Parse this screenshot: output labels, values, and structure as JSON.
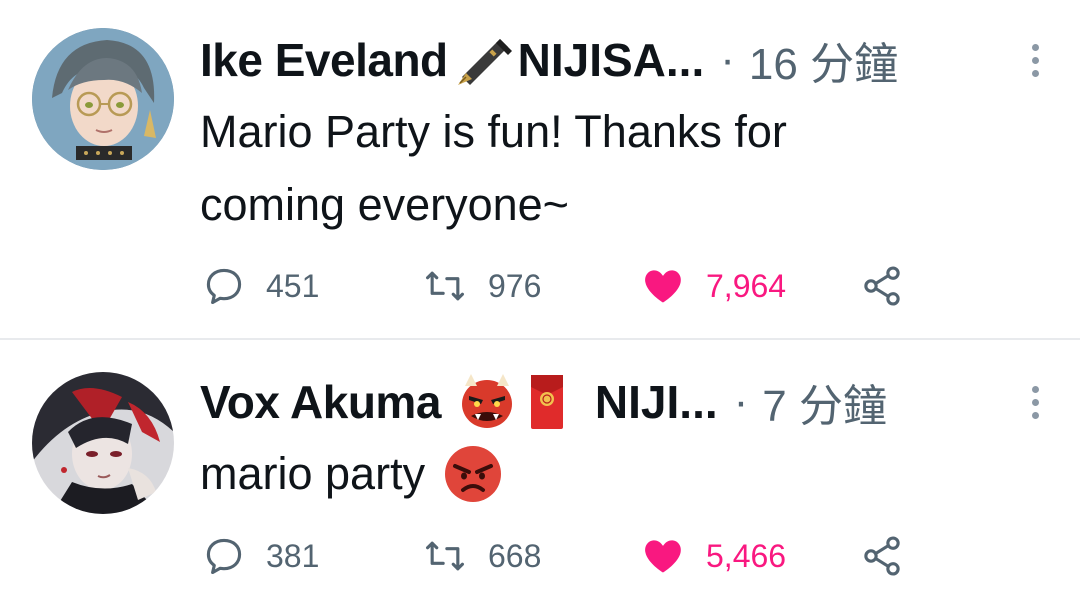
{
  "tweets": [
    {
      "author": "Ike Eveland",
      "handle_trunc": "NIJISA...",
      "separator": "·",
      "time": "16 分鐘",
      "text_line1": "Mario Party is fun! Thanks for",
      "text_line2": "coming everyone~",
      "replies": "451",
      "retweets": "976",
      "likes": "7,964"
    },
    {
      "author": "Vox Akuma",
      "handle_trunc": "NIJI...",
      "separator": "·",
      "time": "7 分鐘",
      "text": "mario party",
      "replies": "381",
      "retweets": "668",
      "likes": "5,466"
    }
  ],
  "colors": {
    "like_pink": "#f91880",
    "muted_gray": "#536471",
    "text": "#0f1419",
    "divider": "#e8eaed"
  },
  "icons": {
    "reply": "reply-icon",
    "retweet": "retweet-icon",
    "like": "heart-icon",
    "share": "share-icon",
    "more": "more-vertical-icon",
    "pen": "fountain-pen-emoji",
    "oni": "ogre-emoji",
    "envelope": "red-envelope-emoji",
    "angry": "angry-face-emoji"
  }
}
